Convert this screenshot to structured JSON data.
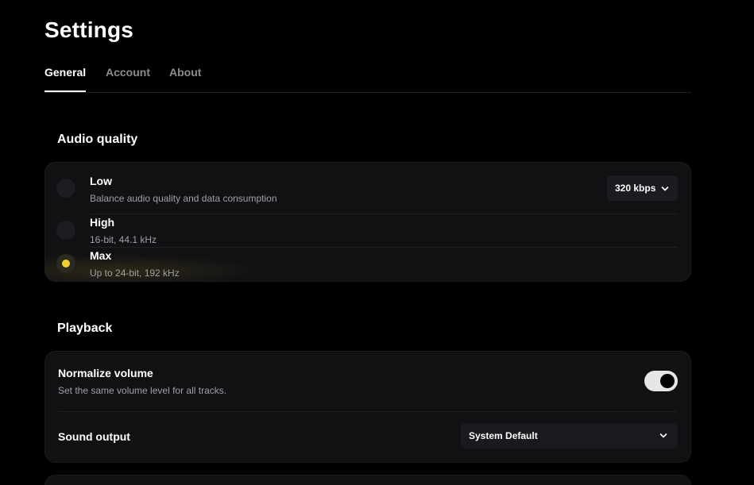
{
  "header": {
    "title": "Settings"
  },
  "tabs": [
    {
      "label": "General",
      "active": true
    },
    {
      "label": "Account",
      "active": false
    },
    {
      "label": "About",
      "active": false
    }
  ],
  "audio_quality": {
    "heading": "Audio quality",
    "bitrate_button": "320 kbps",
    "selected": "Max",
    "options": [
      {
        "title": "Low",
        "subtitle": "Balance audio quality and data consumption"
      },
      {
        "title": "High",
        "subtitle": "16-bit, 44.1 kHz"
      },
      {
        "title": "Max",
        "subtitle": "Up to 24-bit, 192 kHz"
      }
    ]
  },
  "playback": {
    "heading": "Playback",
    "normalize": {
      "title": "Normalize volume",
      "subtitle": "Set the same volume level for all tracks.",
      "enabled": true
    },
    "sound_output": {
      "title": "Sound output",
      "value": "System Default"
    }
  },
  "colors": {
    "accent": "#f2d02b",
    "background": "#000000",
    "card": "#111114",
    "muted_text": "#a0a0a6"
  }
}
